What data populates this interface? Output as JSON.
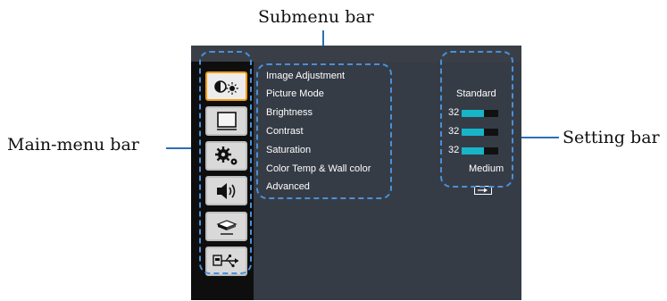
{
  "callouts": {
    "submenu": "Submenu bar",
    "mainmenu": "Main-menu bar",
    "setting": "Setting bar"
  },
  "main_menu": {
    "items": [
      {
        "icon": "image-adjust-icon",
        "selected": true
      },
      {
        "icon": "screen-icon",
        "selected": false
      },
      {
        "icon": "settings-gears-icon",
        "selected": false
      },
      {
        "icon": "volume-icon",
        "selected": false
      },
      {
        "icon": "projector-icon",
        "selected": false
      },
      {
        "icon": "usb-input-icon",
        "selected": false
      }
    ]
  },
  "submenu": {
    "title": "Image Adjustment",
    "items": [
      "Picture Mode",
      "Brightness",
      "Contrast",
      "Saturation",
      "Color Temp & Wall color",
      "Advanced"
    ]
  },
  "settings": {
    "picture_mode": "Standard",
    "brightness": {
      "value": "32",
      "level": 0.6
    },
    "contrast": {
      "value": "32",
      "level": 0.6
    },
    "saturation": {
      "value": "32",
      "level": 0.6
    },
    "color_temp": "Medium",
    "advanced_icon": "enter-icon"
  },
  "colors": {
    "accent_selected": "#f39c12",
    "bar_fill": "#18b4c8",
    "callout_line": "#2e6fb5",
    "dashed_outline": "#4a90d9"
  }
}
